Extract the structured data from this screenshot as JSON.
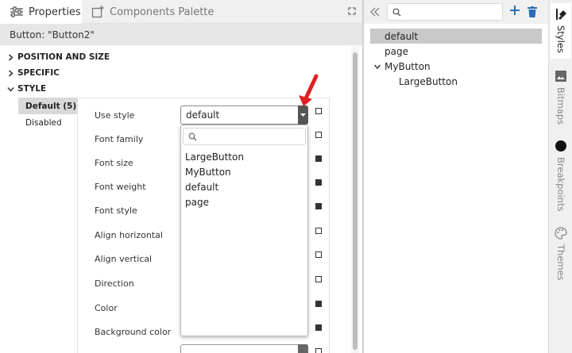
{
  "tabs": {
    "properties": "Properties",
    "components_palette": "Components Palette"
  },
  "selection_label": "Button: \"Button2\"",
  "sections": {
    "position_and_size": "POSITION AND SIZE",
    "specific": "SPECIFIC",
    "style": "STYLE"
  },
  "style_states": [
    {
      "label": "Default (5)",
      "selected": true
    },
    {
      "label": "Disabled",
      "selected": false
    }
  ],
  "properties": [
    {
      "label": "Use style",
      "checked": false
    },
    {
      "label": "Font family",
      "checked": false
    },
    {
      "label": "Font size",
      "checked": true
    },
    {
      "label": "Font weight",
      "checked": true
    },
    {
      "label": "Font style",
      "checked": true
    },
    {
      "label": "Align horizontal",
      "checked": false
    },
    {
      "label": "Align vertical",
      "checked": false
    },
    {
      "label": "Direction",
      "checked": false
    },
    {
      "label": "Color",
      "checked": true
    },
    {
      "label": "Background color",
      "checked": true
    },
    {
      "label": "",
      "checked": false
    }
  ],
  "use_style": {
    "value": "default",
    "options": [
      "LargeButton",
      "MyButton",
      "default",
      "page"
    ]
  },
  "styles_tree": [
    {
      "label": "default",
      "level": 0,
      "selected": true,
      "expandable": false
    },
    {
      "label": "page",
      "level": 0,
      "selected": false,
      "expandable": false
    },
    {
      "label": "MyButton",
      "level": 0,
      "selected": false,
      "expandable": true
    },
    {
      "label": "LargeButton",
      "level": 1,
      "selected": false,
      "expandable": false
    }
  ],
  "side_tabs": [
    {
      "label": "Styles",
      "icon": "styles-icon",
      "active": true
    },
    {
      "label": "Bitmaps",
      "icon": "bitmaps-icon",
      "active": false
    },
    {
      "label": "Breakpoints",
      "icon": "breakpoints-icon",
      "active": false
    },
    {
      "label": "Themes",
      "icon": "themes-icon",
      "active": false
    }
  ],
  "colors": {
    "accent_blue": "#2a6db8",
    "annotation_red": "#e02020",
    "selected_bg": "#c9c9c9"
  }
}
